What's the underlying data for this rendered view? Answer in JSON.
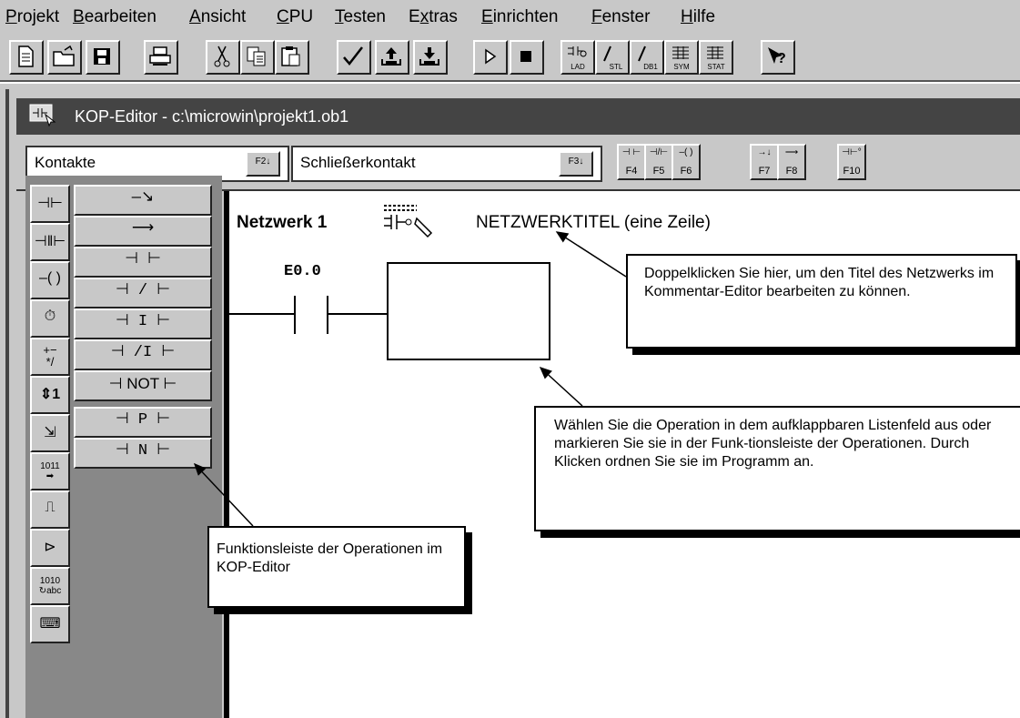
{
  "menu": {
    "items": [
      {
        "key": "P",
        "rest": "rojekt"
      },
      {
        "key": "B",
        "rest": "earbeiten"
      },
      {
        "key": "A",
        "rest": "nsicht"
      },
      {
        "key": "C",
        "rest": "PU"
      },
      {
        "key": "T",
        "rest": "esten"
      },
      {
        "pre": "E",
        "key": "x",
        "rest": "tras"
      },
      {
        "key": "E",
        "rest": "inrichten"
      },
      {
        "key": "F",
        "rest": "enster"
      },
      {
        "key": "H",
        "rest": "ilfe"
      }
    ]
  },
  "toolbar": {
    "tiny_labels": {
      "lad": "LAD",
      "stl": "STL",
      "db1": "DB1",
      "sym": "SYM",
      "stat": "STAT"
    }
  },
  "window": {
    "title": "KOP-Editor - c:\\microwin\\projekt1.ob1"
  },
  "operation_bar": {
    "category_value": "Kontakte",
    "category_key": "F2",
    "operation_value": "Schließerkontakt",
    "operation_key": "F3",
    "fkeys": [
      "F4",
      "F5",
      "F6",
      "F7",
      "F8",
      "F10"
    ]
  },
  "palette": {
    "ops": [
      "—↘",
      "⟶",
      "⊣   ⊢",
      "⊣ / ⊢",
      "⊣ I ⊢",
      "⊣ /I ⊢",
      "⊣ NOT ⊢",
      "⊣ P ⊢",
      "⊣ N ⊢"
    ]
  },
  "editor": {
    "network_label": "Netzwerk 1",
    "network_title": "NETZWERKTITEL (eine Zeile)",
    "contact_address": "E0.0"
  },
  "callouts": {
    "title_hint": "Doppelklicken Sie hier, um den Titel des Netzwerks im Kommentar-Editor bearbeiten zu können.",
    "operation_hint": "Wählen Sie die Operation in dem aufklappbaren Listenfeld aus oder markieren Sie sie in der Funk-tionsleiste der Operationen. Durch Klicken ordnen Sie sie im Programm an.",
    "palette_hint": "Funktionsleiste der Operationen im KOP-Editor"
  }
}
